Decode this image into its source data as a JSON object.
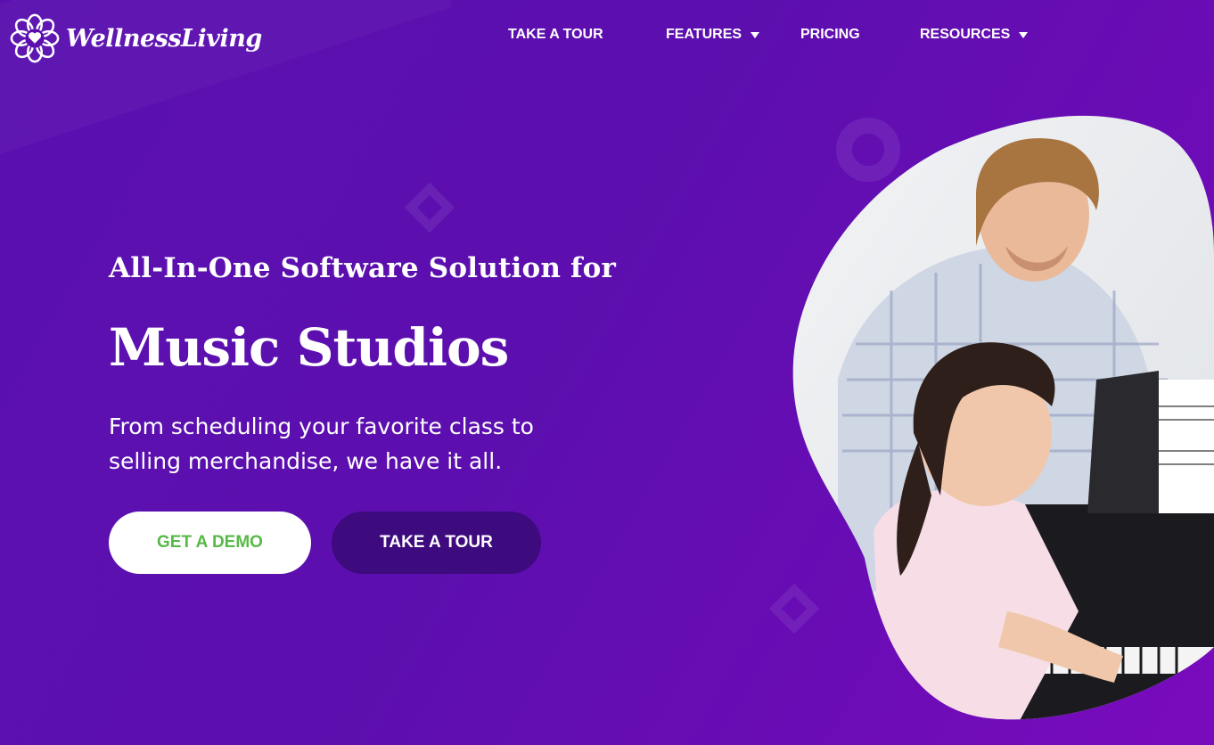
{
  "brand": {
    "name": "WellnessLiving",
    "logo_icon": "flower-heart-icon"
  },
  "nav": {
    "items": [
      {
        "label": "TAKE A TOUR",
        "has_dropdown": false
      },
      {
        "label": "FEATURES",
        "has_dropdown": true
      },
      {
        "label": "PRICING",
        "has_dropdown": false
      },
      {
        "label": "RESOURCES",
        "has_dropdown": true
      }
    ]
  },
  "hero": {
    "kicker": "All-In-One Software Solution for",
    "headline": "Music Studios",
    "subtext": "From scheduling your favorite class to selling merchandise, we have it all.",
    "primary_button": "GET A DEMO",
    "secondary_button": "TAKE A TOUR",
    "image_alt": "Teacher and young girl at a piano"
  },
  "colors": {
    "background": "#5c0fae",
    "primary_button_bg": "#ffffff",
    "primary_button_text": "#57b947",
    "secondary_button_bg": "#3d0b7e",
    "text": "#ffffff"
  }
}
